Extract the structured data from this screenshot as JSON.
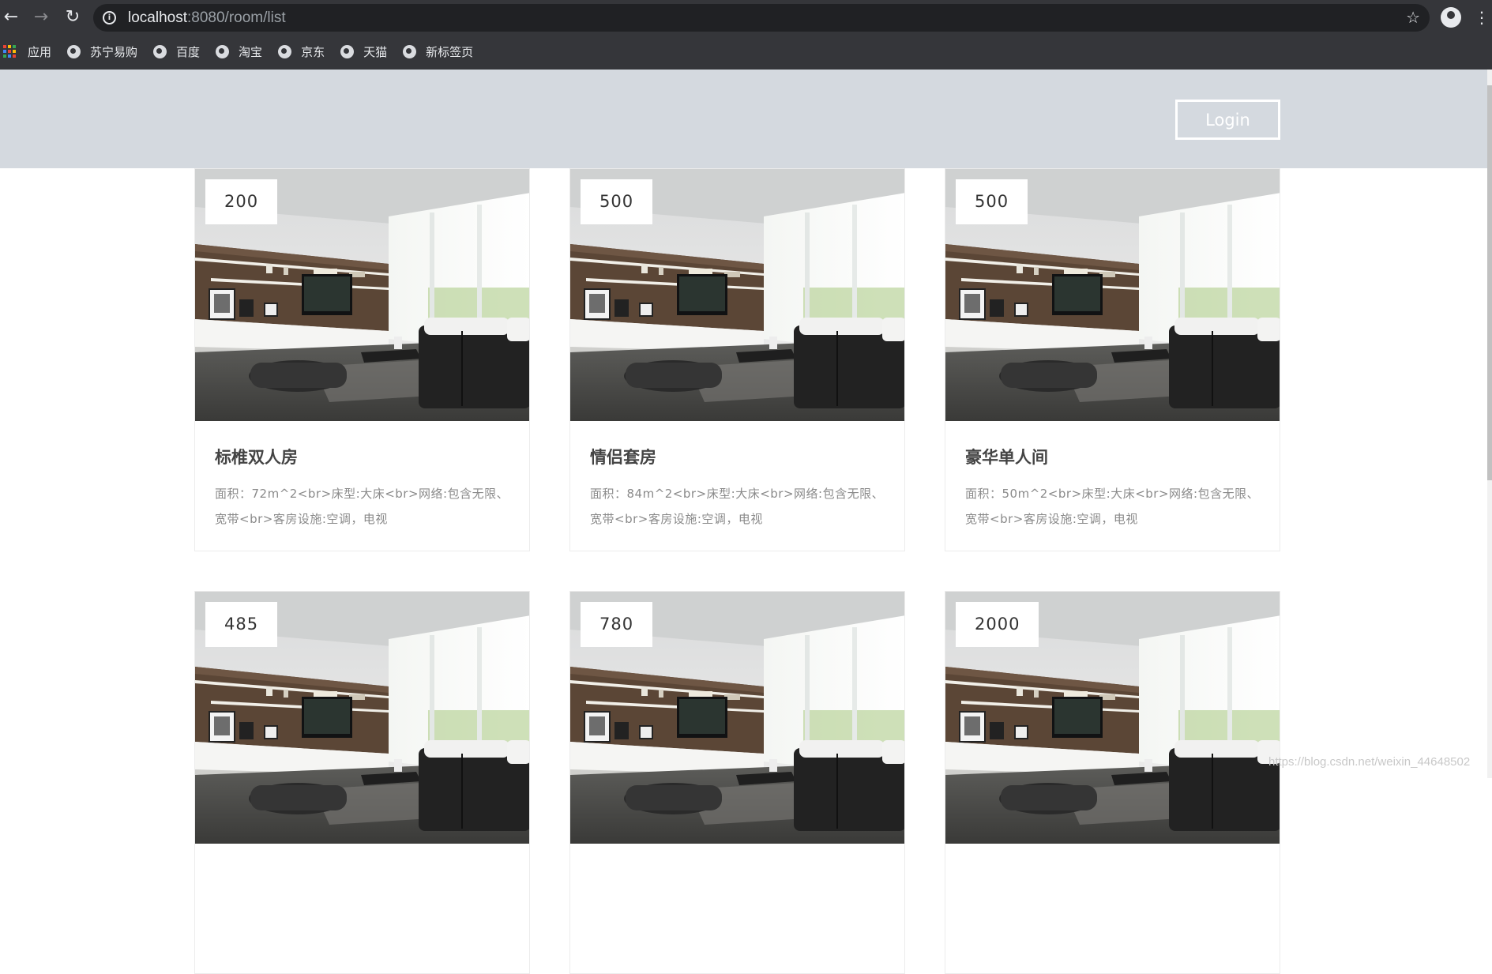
{
  "browser": {
    "url_host": "localhost",
    "url_path": ":8080/room/list",
    "bookmarks": [
      {
        "label": "应用",
        "icon": "apps-grid-icon"
      },
      {
        "label": "苏宁易购",
        "icon": "globe-icon"
      },
      {
        "label": "百度",
        "icon": "globe-icon"
      },
      {
        "label": "淘宝",
        "icon": "globe-icon"
      },
      {
        "label": "京东",
        "icon": "globe-icon"
      },
      {
        "label": "天猫",
        "icon": "globe-icon"
      },
      {
        "label": "新标签页",
        "icon": "globe-icon"
      }
    ]
  },
  "header": {
    "login_label": "Login",
    "background": "#d4d9df"
  },
  "rooms": [
    {
      "price": "200",
      "title": "标椎双人房",
      "desc": "面积：72m^2<br>床型:大床<br>网络:包含无限、宽带<br>客房设施:空调，电视"
    },
    {
      "price": "500",
      "title": "情侣套房",
      "desc": "面积：84m^2<br>床型:大床<br>网络:包含无限、宽带<br>客房设施:空调，电视"
    },
    {
      "price": "500",
      "title": "豪华单人间",
      "desc": "面积：50m^2<br>床型:大床<br>网络:包含无限、宽带<br>客房设施:空调，电视"
    },
    {
      "price": "485",
      "title": "",
      "desc": ""
    },
    {
      "price": "780",
      "title": "",
      "desc": ""
    },
    {
      "price": "2000",
      "title": "",
      "desc": ""
    }
  ],
  "watermark": "https://blog.csdn.net/weixin_44648502"
}
